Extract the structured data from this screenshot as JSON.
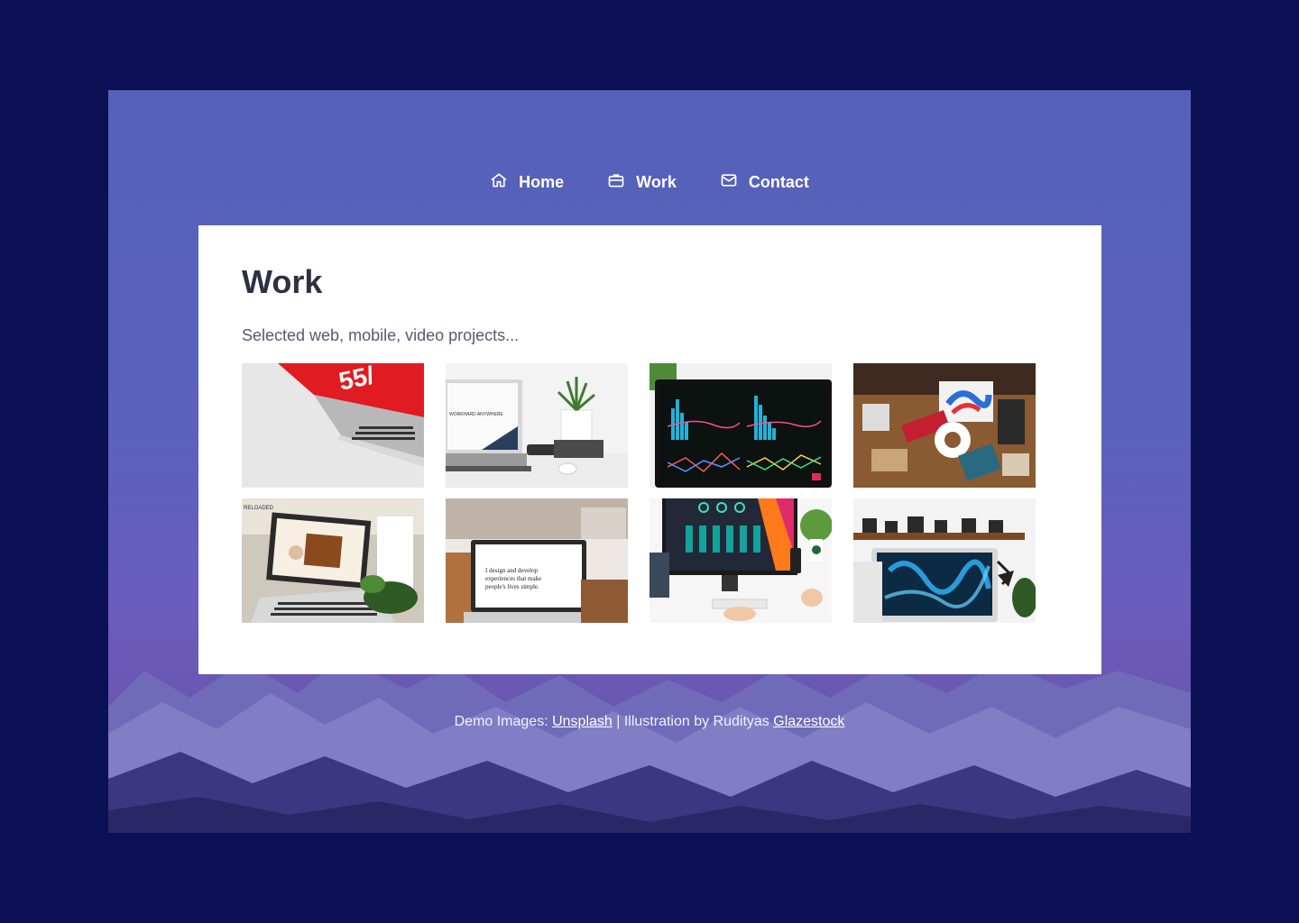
{
  "nav": {
    "items": [
      {
        "label": "Home",
        "icon": "home-icon"
      },
      {
        "label": "Work",
        "icon": "briefcase-icon"
      },
      {
        "label": "Contact",
        "icon": "mail-icon"
      }
    ]
  },
  "main": {
    "title": "Work",
    "subtitle": "Selected web, mobile, video projects..."
  },
  "thumbnails": {
    "t1_text": "55/",
    "t2_text": "WORKHARD ANYWHERE",
    "t6_text": "I design and develop experiences that make people's lives simple."
  },
  "footer": {
    "prefix": "Demo Images: ",
    "link1": "Unsplash",
    "middle": " | Illustration by Rudityas ",
    "link2": "Glazestock"
  },
  "colors": {
    "page_bg": "#0c1054",
    "accent": "#5561b9",
    "title": "#2d3142"
  }
}
